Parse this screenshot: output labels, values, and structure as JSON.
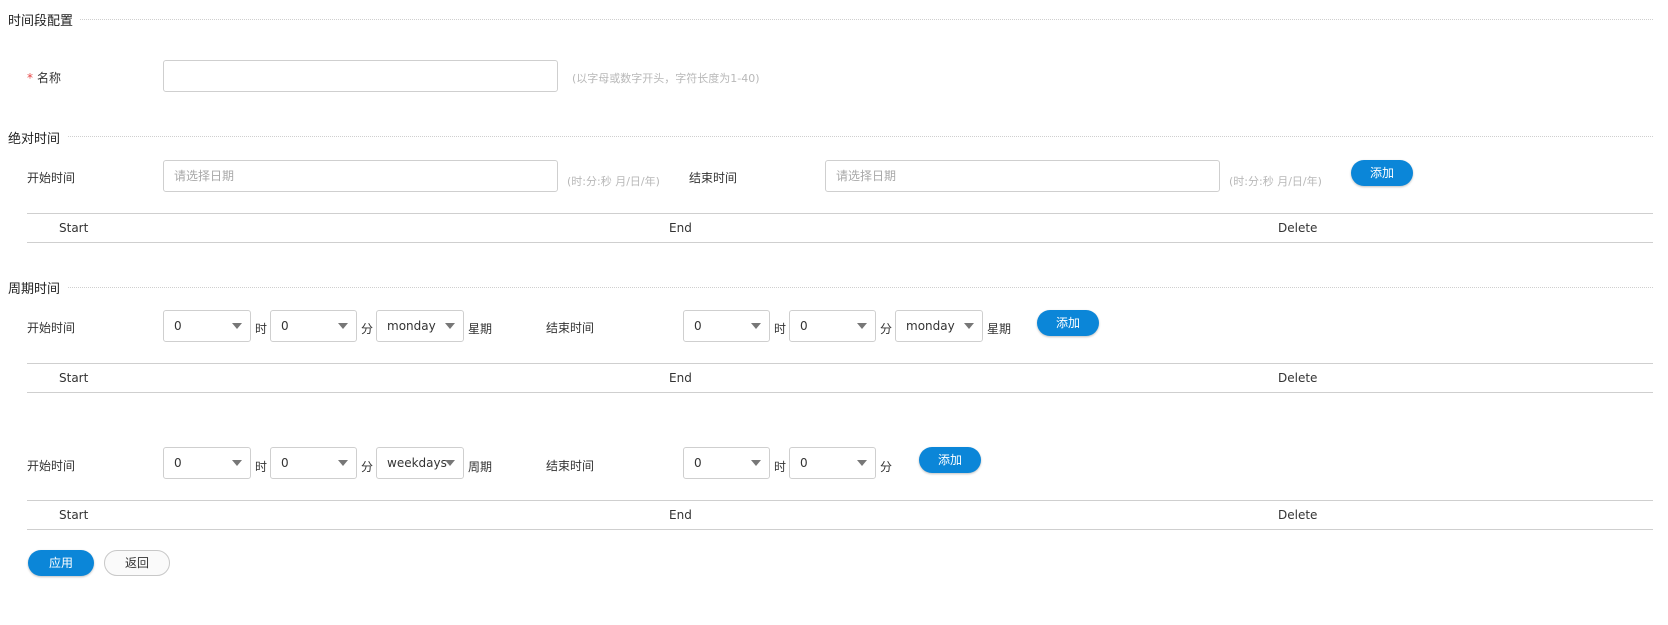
{
  "page": {
    "title": "时间段配置"
  },
  "name_field": {
    "label": "名称",
    "required_mark": "*",
    "value": "",
    "placeholder": "",
    "hint": "(以字母或数字开头，字符长度为1-40)"
  },
  "absolute": {
    "title": "绝对时间",
    "start_label": "开始时间",
    "start_placeholder": "请选择日期",
    "start_hint": "(时:分:秒 月/日/年)",
    "end_label": "结束时间",
    "end_placeholder": "请选择日期",
    "end_hint": "(时:分:秒 月/日/年)",
    "add_label": "添加",
    "table": {
      "columns": [
        "Start",
        "End",
        "Delete"
      ]
    }
  },
  "periodic": {
    "title": "周期时间",
    "weekly": {
      "start_label": "开始时间",
      "start_hour": "0",
      "hour_unit": "时",
      "start_minute": "0",
      "minute_unit": "分",
      "start_day": "monday",
      "day_unit": "星期",
      "end_label": "结束时间",
      "end_hour": "0",
      "end_minute": "0",
      "end_day": "monday",
      "add_label": "添加",
      "table": {
        "columns": [
          "Start",
          "End",
          "Delete"
        ]
      }
    },
    "daily": {
      "start_label": "开始时间",
      "start_hour": "0",
      "hour_unit": "时",
      "start_minute": "0",
      "minute_unit": "分",
      "start_cycle": "weekdays",
      "cycle_unit": "周期",
      "end_label": "结束时间",
      "end_hour": "0",
      "end_minute": "0",
      "add_label": "添加",
      "table": {
        "columns": [
          "Start",
          "End",
          "Delete"
        ]
      }
    }
  },
  "footer": {
    "apply_label": "应用",
    "back_label": "返回"
  },
  "icons": {
    "select_caret": "chevron-down-icon"
  },
  "colors": {
    "primary": "#0b86d8",
    "required": "#e64545",
    "hint": "#b8b8b8",
    "border": "#cfcfcf"
  }
}
